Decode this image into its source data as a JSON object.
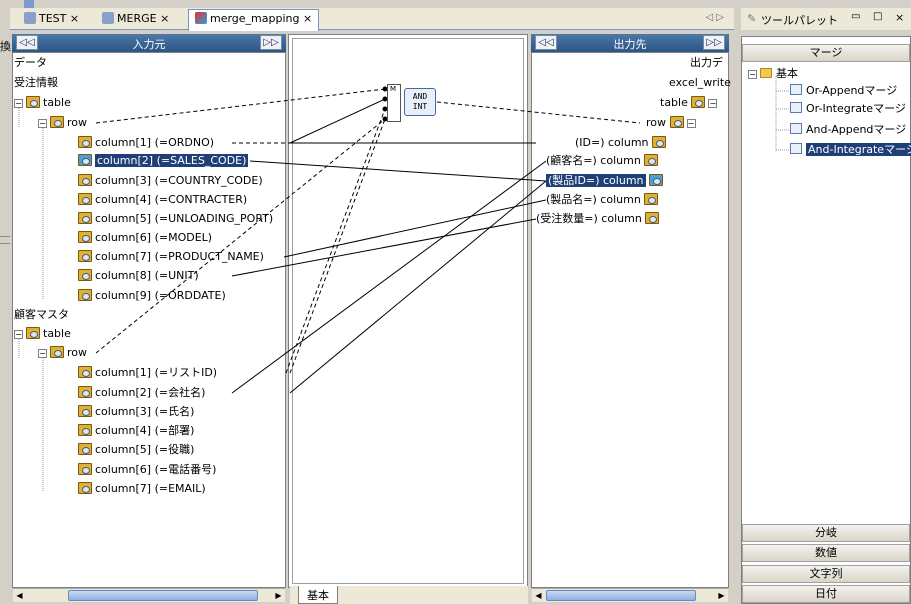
{
  "tabs": [
    "TEST",
    "MERGE",
    "merge_mapping"
  ],
  "tab_close": "×",
  "tab_nav": "◁ ▷",
  "left_edge": {
    "label1": "換"
  },
  "left_pane": {
    "title": "入力元",
    "btn_left": "◁◁",
    "btn_right": "▷▷"
  },
  "right_pane": {
    "title": "出力先",
    "btn_left": "◁◁",
    "btn_right": "▷▷"
  },
  "source_tree": {
    "root": "データ",
    "group1": "受注情報",
    "table": "table",
    "row": "row",
    "cols1": [
      "column[1] (=ORDNO)",
      "column[2] (=SALES_CODE)",
      "column[3] (=COUNTRY_CODE)",
      "column[4] (=CONTRACTER)",
      "column[5] (=UNLOADING_PORT)",
      "column[6] (=MODEL)",
      "column[7] (=PRODUCT_NAME)",
      "column[8] (=UNIT)",
      "column[9] (=ORDDATE)"
    ],
    "group2": "顧客マスタ",
    "cols2": [
      "column[1] (=リストID)",
      "column[2] (=会社名)",
      "column[3] (=氏名)",
      "column[4] (=部署)",
      "column[5] (=役職)",
      "column[6] (=電話番号)",
      "column[7] (=EMAIL)"
    ]
  },
  "target_tree": {
    "root": "出力デ",
    "writer": "excel_write",
    "table": "table",
    "row": "row",
    "cols": [
      "(ID=) column",
      "(顧客名=) column",
      "(製品ID=) column",
      "(製品名=) column",
      "(受注数量=) column"
    ]
  },
  "center": {
    "node_label1": "AND",
    "node_label2": "INT",
    "node_m": "M",
    "tab": "基本"
  },
  "palette": {
    "title": "ツールパレット",
    "category": "マージ",
    "root": "基本",
    "items": [
      "Or-Appendマージ",
      "Or-Integrateマージ",
      "And-Appendマージ",
      "And-Integrateマージ"
    ],
    "bottom_categories": [
      "分岐",
      "数値",
      "文字列",
      "日付"
    ]
  }
}
